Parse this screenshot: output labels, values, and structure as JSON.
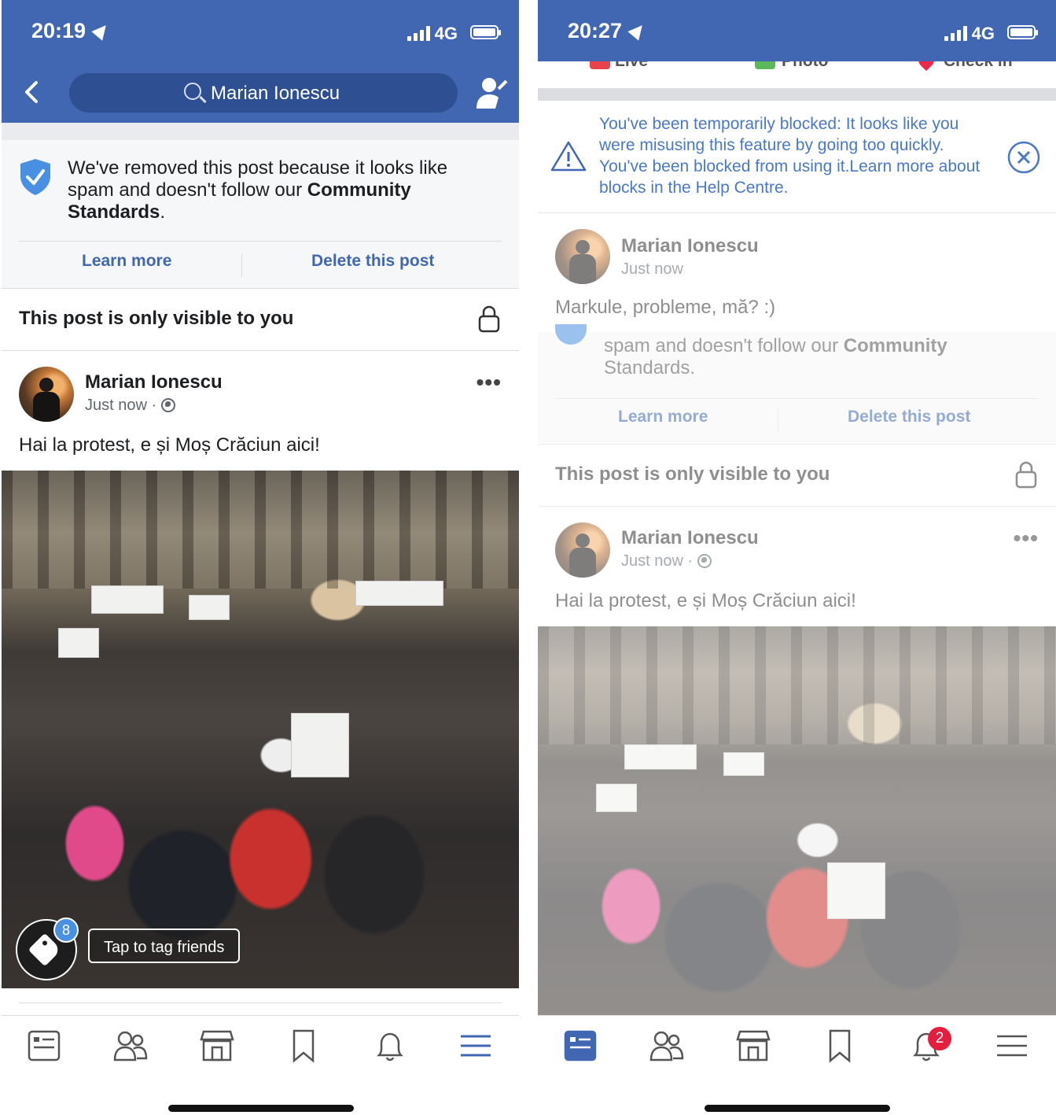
{
  "left": {
    "status": {
      "time": "20:19",
      "network": "4G"
    },
    "search": {
      "value": "Marian Ionescu"
    },
    "notice": {
      "text_pre": "We've removed this post because it looks like spam and doesn't follow our ",
      "text_bold": "Community Standards",
      "text_post": ".",
      "learn_more": "Learn more",
      "delete": "Delete this post"
    },
    "visibility": "This post is only visible to you",
    "post": {
      "author": "Marian Ionescu",
      "time": "Just now",
      "separator": "·",
      "text": "Hai la protest, e și Moș Crăciun aici!",
      "more": "•••"
    },
    "tag": {
      "count": "8",
      "label": "Tap to tag friends"
    }
  },
  "right": {
    "status": {
      "time": "20:27",
      "network": "4G"
    },
    "composer": {
      "live": "Live",
      "photo": "Photo",
      "checkin": "Check in"
    },
    "block": {
      "text": "You've been temporarily blocked: It looks like you were misusing this feature by going too quickly. You've been blocked from using it.Learn more about blocks in the Help Centre."
    },
    "comment": {
      "author": "Marian Ionescu",
      "time": "Just now",
      "text": "Markule, probleme, mă? :)"
    },
    "notice": {
      "text_pre": "spam and doesn't follow our ",
      "text_bold": "Community",
      "text_post": "Standards.",
      "learn_more": "Learn more",
      "delete": "Delete this post"
    },
    "visibility": "This post is only visible to you",
    "post": {
      "author": "Marian Ionescu",
      "time": "Just now",
      "separator": "·",
      "text": "Hai la protest, e și Moș Crăciun aici!",
      "more": "•••"
    },
    "notifications_badge": "2"
  },
  "icons": [
    "news-feed-icon",
    "friends-icon",
    "marketplace-icon",
    "saved-icon",
    "notifications-icon",
    "menu-icon"
  ],
  "colors": {
    "brand": "#4267b2",
    "link": "#4267b2",
    "badge": "#e41e3f"
  }
}
